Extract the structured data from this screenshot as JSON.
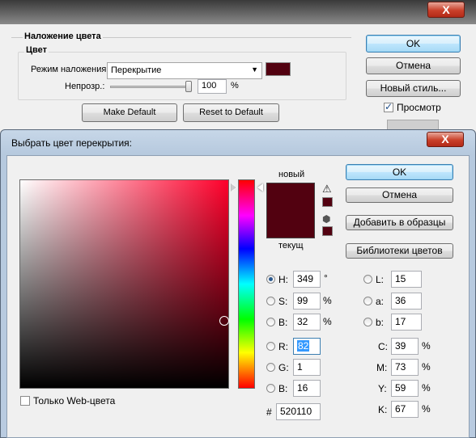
{
  "layer_style": {
    "section_title": "Наложение цвета",
    "group_title": "Цвет",
    "blend_mode_label": "Режим наложения:",
    "blend_mode_value": "Перекрытие",
    "opacity_label": "Непрозр.:",
    "opacity_value": "100",
    "opacity_unit": "%",
    "make_default": "Make Default",
    "reset_default": "Reset to Default",
    "overlay_color": "#520110",
    "ok": "OK",
    "cancel": "Отмена",
    "new_style": "Новый стиль...",
    "preview": "Просмотр",
    "preview_checked": true
  },
  "picker": {
    "title": "Выбрать цвет перекрытия:",
    "new_label": "новый",
    "current_label": "текущ",
    "new_color": "#520110",
    "current_color": "#520110",
    "ok": "OK",
    "cancel": "Отмена",
    "add_swatch": "Добавить в образцы",
    "libraries": "Библиотеки цветов",
    "web_only": "Только Web-цвета",
    "hsb": [
      {
        "key": "H:",
        "value": "349",
        "unit": "°",
        "selected": true
      },
      {
        "key": "S:",
        "value": "99",
        "unit": "%",
        "selected": false
      },
      {
        "key": "B:",
        "value": "32",
        "unit": "%",
        "selected": false
      }
    ],
    "rgb": [
      {
        "key": "R:",
        "value": "82",
        "selected": false
      },
      {
        "key": "G:",
        "value": "1",
        "selected": false
      },
      {
        "key": "B:",
        "value": "16",
        "selected": false
      }
    ],
    "lab": [
      {
        "key": "L:",
        "value": "15"
      },
      {
        "key": "a:",
        "value": "36"
      },
      {
        "key": "b:",
        "value": "17"
      }
    ],
    "cmyk": [
      {
        "key": "C:",
        "value": "39",
        "unit": "%"
      },
      {
        "key": "M:",
        "value": "73",
        "unit": "%"
      },
      {
        "key": "Y:",
        "value": "59",
        "unit": "%"
      },
      {
        "key": "K:",
        "value": "67",
        "unit": "%"
      }
    ],
    "hex_label": "#",
    "hex_value": "520110"
  },
  "window": {
    "close_symbol": "X"
  }
}
